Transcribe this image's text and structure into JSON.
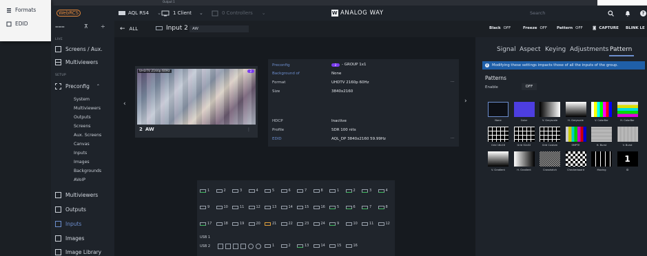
{
  "bg": {
    "formats": "Formats",
    "edid": "EDID",
    "tab_hint": "Output 1"
  },
  "topbar": {
    "logo": "WebRCS",
    "device": "AQL RS4",
    "clients": "1 Client",
    "controllers": "0 Controllers",
    "brand": "ANALOG WAY",
    "search_placeholder": "Search"
  },
  "sidebar": {
    "live": "LIVE",
    "screens": "Screens / Aux.",
    "multiviewers": "Multiviewers",
    "setup": "SETUP",
    "preconfig": "Preconfig",
    "sub": [
      "System",
      "Multiviewers",
      "Outputs",
      "Screens",
      "Aux. Screens",
      "Canvas",
      "Inputs",
      "Images",
      "Backgrounds",
      "AVoIP"
    ],
    "multiviewers2": "Multiviewers",
    "outputs": "Outputs",
    "inputs": "Inputs",
    "images": "Images",
    "image_library": "Image Library"
  },
  "subheader": {
    "back": "ALL",
    "input_name": "Input 2",
    "input_label": "AW",
    "black": "Black",
    "black_state": "OFF",
    "freeze": "Freeze",
    "freeze_state": "OFF",
    "pattern": "Pattern",
    "pattern_state": "OFF",
    "capture": "CAPTURE",
    "blink": "BLINK LE"
  },
  "preview": {
    "format_badge": "UHDTV 2160p 60Hz",
    "num_badge": "2",
    "num": "2",
    "label": "AW"
  },
  "props": [
    {
      "k": "Preconfig",
      "v": "- GROUP 1x1",
      "badge": "2"
    },
    {
      "k": "Background of",
      "v": "None"
    },
    {
      "k": "Format",
      "v": "UHDTV 2160p 60Hz"
    },
    {
      "k": "Size",
      "v": "3840x2160"
    },
    {
      "k": "HDCP",
      "v": "Inactive"
    },
    {
      "k": "Profile",
      "v": "SDR 100 nits"
    },
    {
      "k": "EDID",
      "v": "AQL_DP 3840x2160 59.99Hz"
    }
  ],
  "tabs": [
    "Signal",
    "Aspect",
    "Keying",
    "Adjustments",
    "Pattern"
  ],
  "info": "Modifying these settings impacts those of all the inputs of the group.",
  "patterns": {
    "title": "Patterns",
    "enable": "Enable",
    "enable_state": "OFF",
    "items": [
      "None",
      "Color",
      "V. Greyscale",
      "H. Greyscale",
      "V. ColorBar",
      "H. ColorBar",
      "Grid 16x16",
      "Grid 32x32",
      "Grid Custom",
      "SMPTE",
      "H. Burst",
      "V. Burst",
      "V. Gradient",
      "H. Gradient",
      "Crosshatch",
      "Checkerboard",
      "Moving",
      "ID"
    ]
  },
  "connectors": {
    "row1": [
      "1",
      "2",
      "3",
      "4",
      "5",
      "6",
      "7",
      "8",
      "1",
      "2",
      "3",
      "4"
    ],
    "row2": [
      "9",
      "10",
      "11",
      "12",
      "13",
      "14",
      "15",
      "16",
      "5",
      "6",
      "7",
      "8"
    ],
    "row3": [
      "17",
      "18",
      "19",
      "20",
      "21",
      "22",
      "23",
      "24",
      "9",
      "10",
      "11",
      "12"
    ],
    "usb1": "USB 1",
    "usb2": "USB 2",
    "row5": [
      "1",
      "2",
      "13",
      "14",
      "15",
      "16"
    ]
  },
  "colors": {
    "accent": "#7a3cf0",
    "link": "#6d8fd0",
    "info_bar": "#1f5fa8",
    "active_input": "#4a6fd1"
  }
}
